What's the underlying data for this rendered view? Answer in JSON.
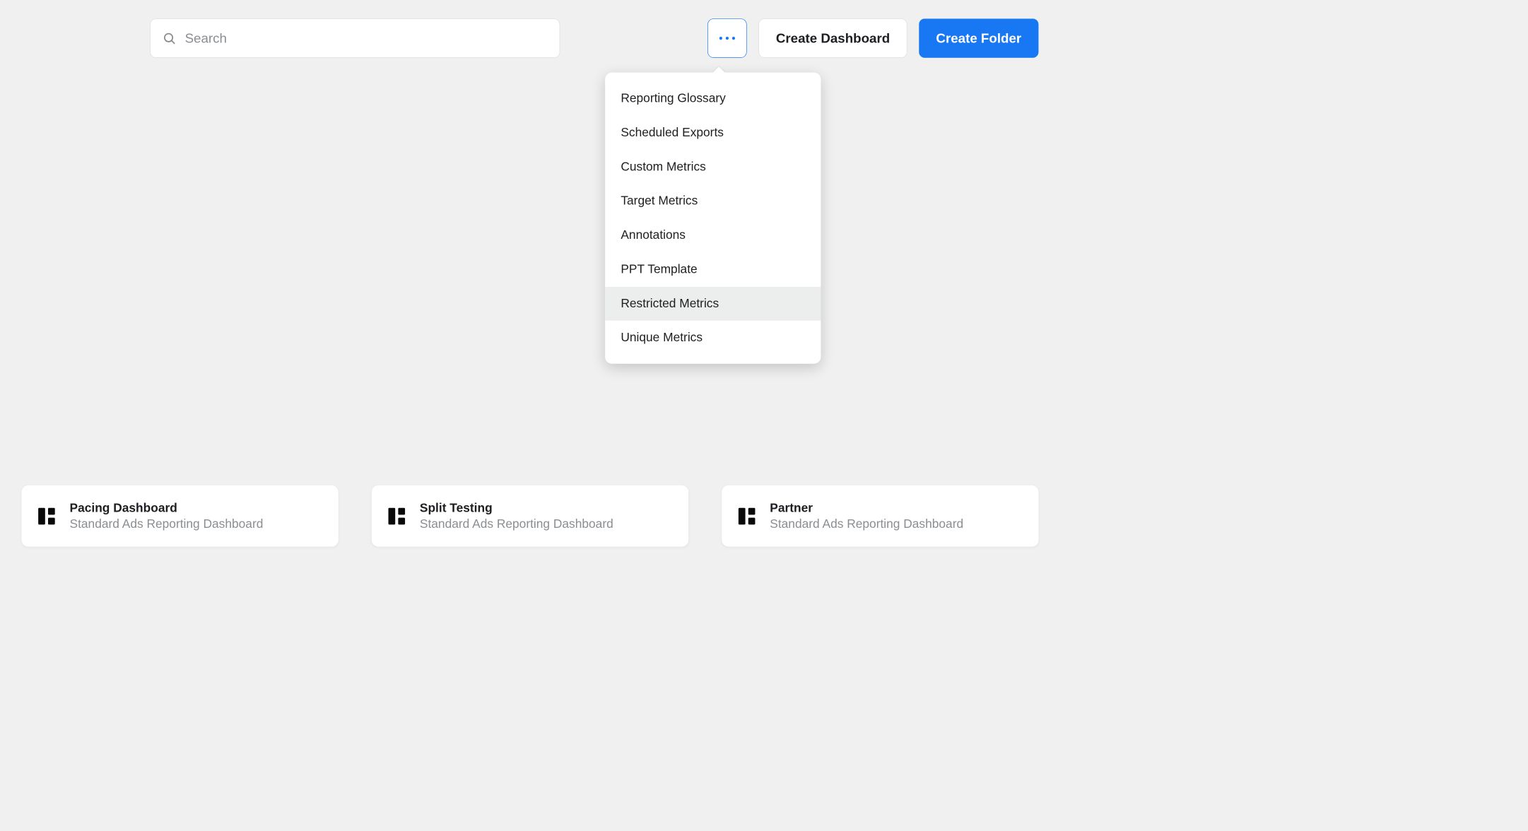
{
  "search": {
    "placeholder": "Search",
    "value": ""
  },
  "toolbar": {
    "create_dashboard": "Create Dashboard",
    "create_folder": "Create Folder"
  },
  "more_menu": {
    "items": [
      {
        "label": "Reporting Glossary",
        "hover": false
      },
      {
        "label": "Scheduled Exports",
        "hover": false
      },
      {
        "label": "Custom Metrics",
        "hover": false
      },
      {
        "label": "Target Metrics",
        "hover": false
      },
      {
        "label": "Annotations",
        "hover": false
      },
      {
        "label": "PPT Template",
        "hover": false
      },
      {
        "label": "Restricted Metrics",
        "hover": true
      },
      {
        "label": "Unique Metrics",
        "hover": false
      }
    ]
  },
  "cards": [
    {
      "title": "Pacing Dashboard",
      "subtitle": "Standard Ads Reporting Dashboard"
    },
    {
      "title": "Split Testing",
      "subtitle": "Standard Ads Reporting Dashboard"
    },
    {
      "title": "Partner",
      "subtitle": "Standard Ads Reporting Dashboard"
    }
  ],
  "colors": {
    "primary": "#1877f2",
    "page_bg": "#f0f0f0",
    "card_bg": "#ffffff"
  }
}
